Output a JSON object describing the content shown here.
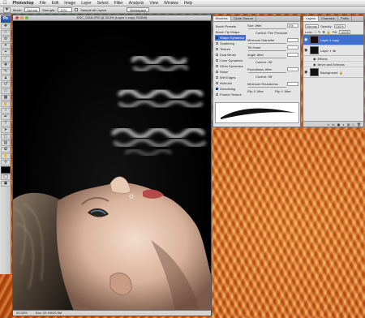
{
  "menubar": {
    "apple": "",
    "app": "Photoshop",
    "items": [
      "File",
      "Edit",
      "Image",
      "Layer",
      "Select",
      "Filter",
      "Analysis",
      "View",
      "Window",
      "Help"
    ],
    "clock": ""
  },
  "options": {
    "mode_label": "Mode:",
    "mode_value": "Normal",
    "strength_label": "Strength:",
    "strength_value": "10%",
    "sample_label": "Sample All Layers",
    "workspace_label": "Workspace"
  },
  "toolbox": {
    "logo": "Ps"
  },
  "document": {
    "title": "DSC_0318.JPG @ 33.3% (Layer 1 copy, RGB/8)",
    "zoom": "33.33%",
    "doc_info": "Doc: 22.1M/20.5M"
  },
  "brushes": {
    "tabs": [
      "Brushes",
      "Clone Source"
    ],
    "list": [
      {
        "label": "Brush Presets",
        "on": false
      },
      {
        "label": "Brush Tip Shape",
        "on": false
      },
      {
        "label": "Shape Dynamics",
        "on": true,
        "selected": true
      },
      {
        "label": "Scattering",
        "on": false
      },
      {
        "label": "Texture",
        "on": false
      },
      {
        "label": "Dual Brush",
        "on": false
      },
      {
        "label": "Color Dynamics",
        "on": false
      },
      {
        "label": "Other Dynamics",
        "on": false
      },
      {
        "label": "Noise",
        "on": false
      },
      {
        "label": "Wet Edges",
        "on": false
      },
      {
        "label": "Airbrush",
        "on": false
      },
      {
        "label": "Smoothing",
        "on": true
      },
      {
        "label": "Protect Texture",
        "on": false
      }
    ],
    "options": [
      {
        "label": "Size Jitter",
        "control": "",
        "value": "0%"
      },
      {
        "label": "",
        "control": "Control: Pen Pressure",
        "value": ""
      },
      {
        "label": "Minimum Diameter",
        "control": "",
        "value": ""
      },
      {
        "label": "Tilt Scale",
        "control": "",
        "value": ""
      },
      {
        "label": "Angle Jitter",
        "control": "",
        "value": ""
      },
      {
        "label": "",
        "control": "Control: Off",
        "value": ""
      },
      {
        "label": "Roundness Jitter",
        "control": "",
        "value": ""
      },
      {
        "label": "",
        "control": "Control: Off",
        "value": ""
      },
      {
        "label": "Minimum Roundness",
        "control": "",
        "value": ""
      },
      {
        "label": "Flip X Jitter",
        "control": "Flip Y Jitter",
        "value": ""
      }
    ]
  },
  "layers": {
    "tabs": [
      "Layers",
      "Channels",
      "Paths"
    ],
    "blend_mode": "Normal",
    "opacity_label": "Opacity:",
    "opacity_value": "100%",
    "lock_label": "Lock:",
    "fill_label": "Fill:",
    "fill_value": "100%",
    "items": [
      {
        "name": "Layer 1 copy",
        "selected": true
      },
      {
        "name": "Layer 1",
        "selected": false
      }
    ],
    "effects_label": "Effects",
    "effect_item": "Bevel and Emboss",
    "background_label": "Background"
  }
}
